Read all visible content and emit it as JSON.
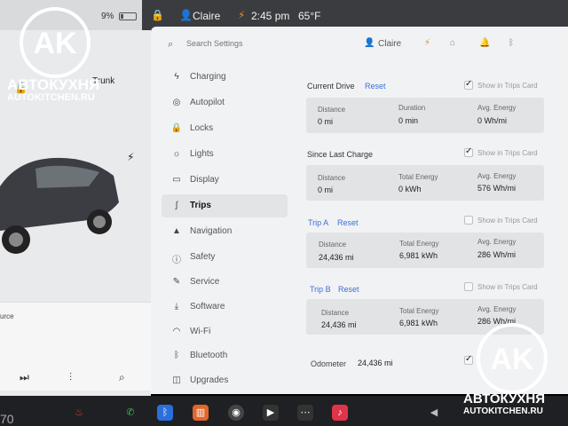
{
  "status_bar": {
    "battery_pct": "9%",
    "user": "Claire",
    "time": "2:45 pm",
    "temperature": "65°F"
  },
  "car_panel": {
    "trunk_label": "Trunk",
    "media_source": "urce"
  },
  "settings": {
    "search_placeholder": "Search Settings",
    "user": "Claire",
    "nav": [
      {
        "label": "Charging",
        "icon": "bolt-icon"
      },
      {
        "label": "Autopilot",
        "icon": "steering-wheel-icon"
      },
      {
        "label": "Locks",
        "icon": "lock-icon"
      },
      {
        "label": "Lights",
        "icon": "sun-icon"
      },
      {
        "label": "Display",
        "icon": "display-icon"
      },
      {
        "label": "Trips",
        "icon": "trips-icon",
        "active": true
      },
      {
        "label": "Navigation",
        "icon": "navigation-icon"
      },
      {
        "label": "Safety",
        "icon": "safety-icon"
      },
      {
        "label": "Service",
        "icon": "wrench-icon"
      },
      {
        "label": "Software",
        "icon": "download-icon"
      },
      {
        "label": "Wi-Fi",
        "icon": "wifi-icon"
      },
      {
        "label": "Bluetooth",
        "icon": "bluetooth-icon"
      },
      {
        "label": "Upgrades",
        "icon": "bag-icon"
      }
    ]
  },
  "trips": {
    "show_label": "Show in Trips Card",
    "current_drive": {
      "title": "Current Drive",
      "reset": "Reset",
      "distance_label": "Distance",
      "distance": "0 mi",
      "duration_label": "Duration",
      "duration": "0 min",
      "avg_label": "Avg. Energy",
      "avg": "0 Wh/mi"
    },
    "since_last_charge": {
      "title": "Since Last Charge",
      "distance_label": "Distance",
      "distance": "0 mi",
      "total_label": "Total Energy",
      "total": "0 kWh",
      "avg_label": "Avg. Energy",
      "avg": "576 Wh/mi"
    },
    "trip_a": {
      "title": "Trip A",
      "reset": "Reset",
      "distance_label": "Distance",
      "distance": "24,436 mi",
      "total_label": "Total Energy",
      "total": "6,981 kWh",
      "avg_label": "Avg. Energy",
      "avg": "286 Wh/mi"
    },
    "trip_b": {
      "title": "Trip B",
      "reset": "Reset",
      "distance_label": "Distance",
      "distance": "24,436 mi",
      "total_label": "Total Energy",
      "total": "6,981 kWh",
      "avg_label": "Avg. Energy",
      "avg": "286 Wh/mi"
    },
    "odometer_label": "Odometer",
    "odometer": "24,436 mi"
  },
  "dock": {
    "speed_fragment": "70"
  },
  "watermark": {
    "brand": "АВТОКУХНЯ",
    "url": "AUTOKITCHEN.RU",
    "monogram": "AK"
  }
}
